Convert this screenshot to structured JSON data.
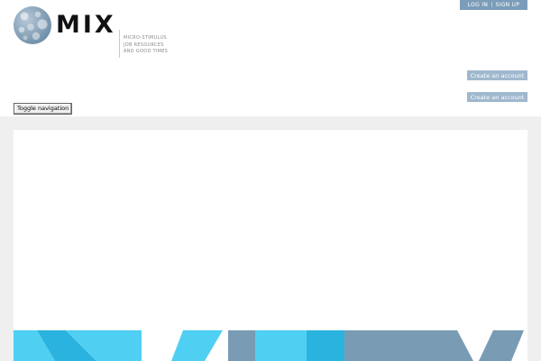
{
  "header": {
    "auth": {
      "login_label": "LOG IN",
      "separator": "|",
      "signup_label": "SIGN UP"
    },
    "brand": {
      "name": "MIX",
      "tagline": [
        "MICRO-STIMULUS",
        "JOB RESOURCES",
        "AND GOOD TIMES"
      ]
    },
    "create_account_label": "Create an account",
    "create_account_label_2": "Create an account",
    "toggle_navigation_label": "Toggle navigation"
  },
  "colors": {
    "accent_blue": "#7b9db9",
    "button_blue": "#9fb8cd",
    "hero_cyan": "#4fd0f3",
    "hero_cyan_deep": "#2ab3de",
    "hero_steel": "#7a9bb4",
    "band_grey": "#efefef"
  },
  "icons": {
    "logo": "globe-logo-icon"
  }
}
